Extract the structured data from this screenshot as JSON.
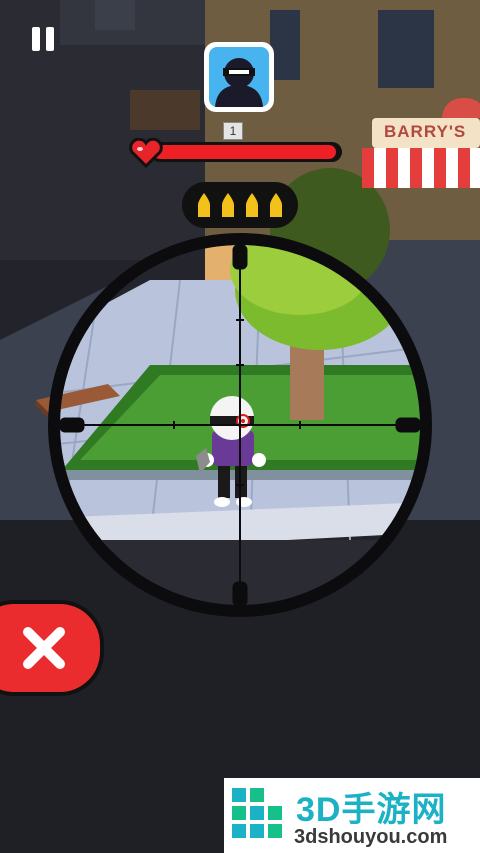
{
  "hud": {
    "target_count": "1",
    "health_fraction": 0.985,
    "ammo_remaining": 4,
    "icons": {
      "pause": "pause-icon",
      "heart": "heart-icon",
      "target": "target-portrait-icon",
      "bullet": "bullet-icon",
      "cancel": "close-icon"
    }
  },
  "scene": {
    "shop_sign": "BARRY'S"
  },
  "watermark": {
    "title": "3D手游网",
    "url": "3dshouyou.com"
  },
  "colors": {
    "health": "#ee1f25",
    "cancel_button": "#ea2c2f",
    "portrait_bg": "#47b4ef",
    "bullet": "#f2c21a",
    "grass": "#3f8f2b",
    "watermark": "#1bb2c5"
  }
}
